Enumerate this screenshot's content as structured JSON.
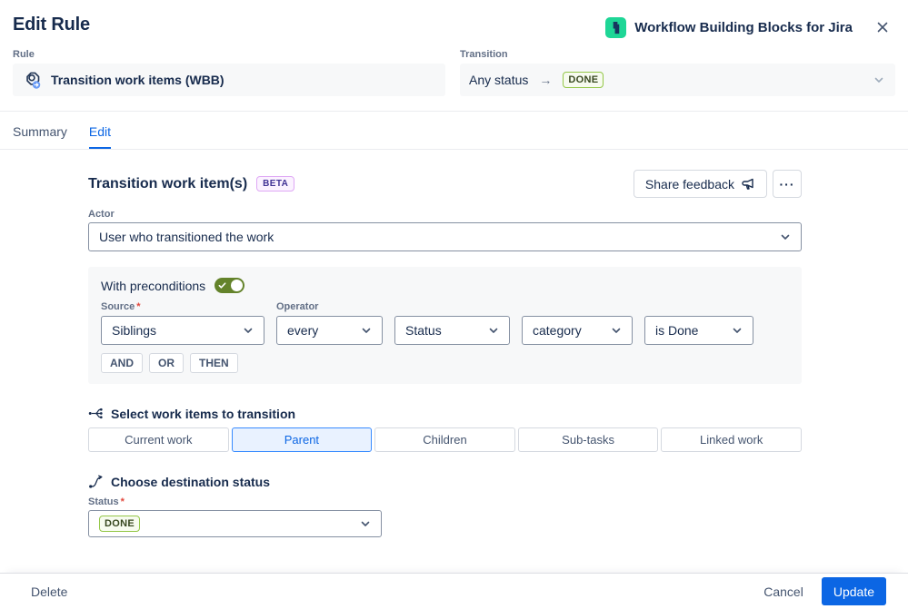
{
  "header": {
    "title": "Edit Rule",
    "app_name": "Workflow Building Blocks for Jira"
  },
  "rule_section": {
    "label": "Rule",
    "value": "Transition work items (WBB)"
  },
  "transition_section": {
    "label": "Transition",
    "from": "Any status",
    "arrow": "→",
    "to_badge": "DONE"
  },
  "tabs": [
    {
      "label": "Summary",
      "active": false
    },
    {
      "label": "Edit",
      "active": true
    }
  ],
  "main": {
    "heading": "Transition work item(s)",
    "beta_badge": "BETA",
    "share_feedback_label": "Share feedback",
    "more_label": "···",
    "actor": {
      "label": "Actor",
      "value": "User who transitioned the work"
    },
    "preconditions": {
      "toggle_label": "With preconditions",
      "toggle_on": true,
      "required_mark": "*",
      "source": {
        "label": "Source",
        "value": "Siblings"
      },
      "operator": {
        "label": "Operator",
        "value": "every"
      },
      "field_value": "Status",
      "attribute_value": "category",
      "condition_value": "is Done",
      "logic_buttons": [
        "AND",
        "OR",
        "THEN"
      ]
    },
    "work_items": {
      "heading": "Select work items to transition",
      "options": [
        "Current work",
        "Parent",
        "Children",
        "Sub-tasks",
        "Linked work"
      ],
      "selected": "Parent"
    },
    "destination": {
      "heading": "Choose destination status",
      "status_label": "Status",
      "required_mark": "*",
      "value_badge": "DONE"
    }
  },
  "footer": {
    "delete_label": "Delete",
    "cancel_label": "Cancel",
    "update_label": "Update"
  },
  "icons": {
    "app_icon": "green-block-logo",
    "close_icon": "x-close",
    "rule_icon": "automation-hexagon-nut",
    "feedback_icon": "megaphone",
    "work_items_icon": "tree-branch",
    "destination_icon": "curved-transition-arrow",
    "chevron_icon": "chevron-down",
    "toggle_check_icon": "checkmark"
  },
  "colors": {
    "accent_blue": "#0C66E4",
    "selected_bg": "#E9F2FF",
    "selected_border": "#388BFF",
    "toggle_on": "#64832B",
    "lozenge_bg": "#F7FBEF",
    "lozenge_border": "#94C748",
    "lozenge_text": "#37471F",
    "beta_bg": "#FBF2FF",
    "beta_border": "#DFA8F5",
    "beta_text": "#403294",
    "app_icon_green": "#1ED696",
    "panel_bg": "#F7F8F9"
  }
}
